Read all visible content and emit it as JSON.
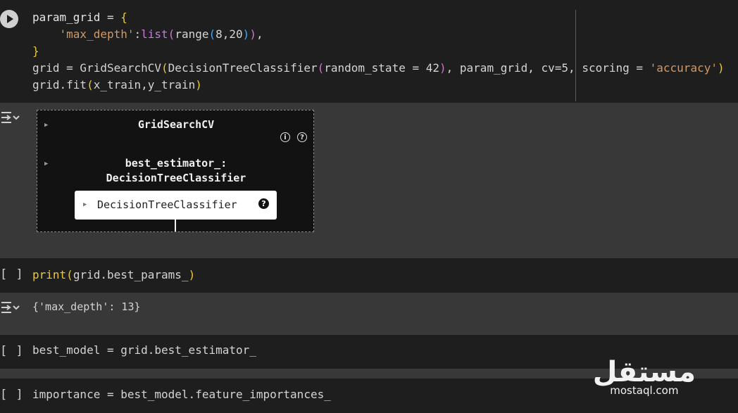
{
  "cells": [
    {
      "type": "code",
      "lines": {
        "l1_a": "param_grid",
        "l1_b": " = ",
        "l1_c": "{",
        "l2_a": "    'max_depth'",
        "l2_b": ":",
        "l2_c": "list",
        "l2_d": "(",
        "l2_e": "range",
        "l2_f": "(",
        "l2_g": "8",
        "l2_h": ",",
        "l2_i": "20",
        "l2_j": ")",
        "l2_k": ")",
        "l2_l": ",",
        "l3_a": "}",
        "l4_a": "grid = GridSearchCV",
        "l4_b": "(",
        "l4_c": "DecisionTreeClassifier",
        "l4_d": "(",
        "l4_e": "random_state = ",
        "l4_f": "42",
        "l4_g": ")",
        "l4_h": ", param_grid, cv=",
        "l4_i": "5",
        "l4_j": ", scoring = ",
        "l4_k": "'accuracy'",
        "l4_l": ")",
        "l5_a": "grid.fit",
        "l5_b": "(",
        "l5_c": "x_train,y_train",
        "l5_d": ")"
      }
    }
  ],
  "output1": {
    "title": "GridSearchCV",
    "info_icon": "i",
    "help_icon": "?",
    "best_estimator_line1": "best_estimator_:",
    "best_estimator_line2": "DecisionTreeClassifier",
    "estimator_label": "DecisionTreeClassifier",
    "estimator_help": "?"
  },
  "cell2": {
    "bracket": "[ ]",
    "a": "print",
    "b": "(",
    "c": "grid.best_params_",
    "d": ")"
  },
  "output2": {
    "text": "{'max_depth': 13}"
  },
  "cell3": {
    "bracket": "[ ]",
    "code": "best_model = grid.best_estimator_"
  },
  "cell4": {
    "bracket": "[ ]",
    "code": "importance = best_model.feature_importances_"
  },
  "watermark": {
    "arabic": "مستقل",
    "latin": "mostaql.com"
  },
  "colors": {
    "code_bg": "#1e1e1e",
    "output_bg": "#383838",
    "string": "#d19a66",
    "brace": "#e8c93b"
  },
  "icons": [
    "run-cell-icon",
    "output-toggle-icon",
    "info-icon",
    "help-icon"
  ]
}
